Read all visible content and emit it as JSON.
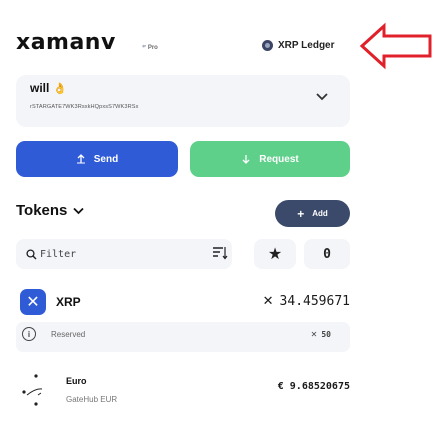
{
  "header": {
    "logo": "xamanv",
    "logo_badge": "Pro",
    "network": "XRP Ledger"
  },
  "account": {
    "name": "will",
    "hand_emoji": "👌",
    "address": "rSTARGATE7WK3RsxkHQpxsS7WK3RSx"
  },
  "actions": {
    "send_label": "Send",
    "request_label": "Request"
  },
  "tokens": {
    "title": "Tokens",
    "add_label": "Add",
    "filter_placeholder": "Filter",
    "zero_label": "0"
  },
  "token_list": {
    "xrp": {
      "name": "XRP",
      "balance_symbol": "✕",
      "balance": "34.459671",
      "reserved_label": "Reserved",
      "reserved_symbol": "✕",
      "reserved_amount": "50"
    },
    "euro": {
      "name": "Euro",
      "issuer": "GateHub EUR",
      "balance": "€ 9.68520675"
    }
  },
  "colors": {
    "primary_blue": "#2f5bd7",
    "request_green": "#5fd08a",
    "add_button": "#3b4a6b",
    "arrow_red": "#e0202a",
    "panel_bg": "#f4f5f9"
  }
}
